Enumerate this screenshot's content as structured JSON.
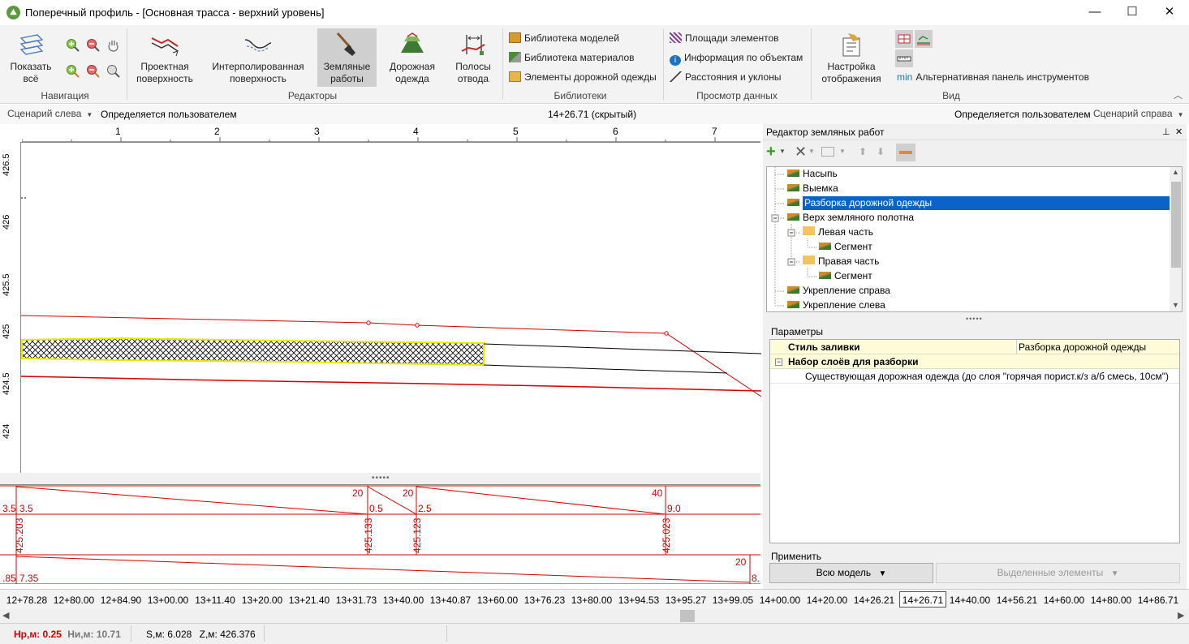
{
  "window": {
    "title": "Поперечный профиль - [Основная трасса - верхний уровень]",
    "controls": {
      "minimize": "—",
      "maximize": "☐",
      "close": "✕"
    }
  },
  "ribbon": {
    "navigation": {
      "show_all": "Показать всё",
      "group": "Навигация"
    },
    "editors": {
      "design_surface": "Проектная поверхность",
      "interpolated_surface": "Интерполированная поверхность",
      "earthworks": "Земляные работы",
      "pavement": "Дорожная одежда",
      "right_of_way": "Полосы отвода",
      "group": "Редакторы"
    },
    "libraries": {
      "models": "Библиотека моделей",
      "materials": "Библиотека материалов",
      "pavement_elements": "Элементы дорожной одежды",
      "group": "Библиотеки"
    },
    "data_view": {
      "element_areas": "Площади элементов",
      "object_info": "Информация по объектам",
      "distances": "Расстояния и уклоны",
      "group": "Просмотр данных"
    },
    "view": {
      "display_settings": "Настройка отображения",
      "alt_toolbar_prefix": "min",
      "alt_toolbar": "Альтернативная панель инструментов",
      "group": "Вид"
    }
  },
  "scenario_bar": {
    "left_scenario": "Сценарий слева",
    "left_value": "Определяется пользователем",
    "station": "14+26.71 (скрытый)",
    "right_value": "Определяется пользователем",
    "right_scenario": "Сценарий справа"
  },
  "ruler_top": [
    "1",
    "2",
    "3",
    "4",
    "5",
    "6",
    "7"
  ],
  "ruler_left": [
    "426.5",
    "426",
    "425.5",
    "425",
    "424.5",
    "424"
  ],
  "profile_grid": {
    "row1": [
      "20",
      "20",
      "40"
    ],
    "row2": [
      "3.5",
      "3.5",
      "0.5",
      "2.5",
      "9.0"
    ],
    "row3": [
      "425.203",
      "425.133",
      "425.123",
      "425.023"
    ],
    "row4": [
      "20",
      ".85",
      "7.35",
      "8."
    ]
  },
  "stations": [
    "12+78.28",
    "12+80.00",
    "12+84.90",
    "13+00.00",
    "13+11.40",
    "13+20.00",
    "13+21.40",
    "13+31.73",
    "13+40.00",
    "13+40.87",
    "13+60.00",
    "13+76.23",
    "13+80.00",
    "13+94.53",
    "13+95.27",
    "13+99.05",
    "14+00.00",
    "14+20.00",
    "14+26.21",
    "14+26.71",
    "14+40.00",
    "14+56.21",
    "14+60.00",
    "14+80.00",
    "14+86.71"
  ],
  "selected_station": "14+26.71",
  "statusbar": {
    "hr_label": "Нр,м:",
    "hr_value": "0.25",
    "hi_label": "Ни,м:",
    "hi_value": "10.71",
    "s_label": "S,м:",
    "s_value": "6.028",
    "z_label": "Z,м:",
    "z_value": "426.376"
  },
  "earthworks_editor": {
    "title": "Редактор земляных работ",
    "tree": [
      {
        "label": "Насыпь"
      },
      {
        "label": "Выемка"
      },
      {
        "label": "Разборка дорожной одежды"
      },
      {
        "label": "Верх земляного полотна"
      },
      {
        "label": "Левая часть"
      },
      {
        "label": "Сегмент"
      },
      {
        "label": "Правая часть"
      },
      {
        "label": "Сегмент"
      },
      {
        "label": "Укрепление справа"
      },
      {
        "label": "Укрепление слева"
      }
    ],
    "params_title": "Параметры",
    "params": {
      "fill_style_label": "Стиль заливки",
      "fill_style_value": "Разборка дорожной одежды",
      "layer_set_label": "Набор слоёв для разборки",
      "layer_item": "Существующая дорожная одежда (до слоя \"горячая порист.к/з а/б смесь, 10см\")"
    },
    "apply_title": "Применить",
    "apply_all": "Всю модель",
    "apply_selected": "Выделенные элементы"
  },
  "colors": {
    "accent_red": "#d40000",
    "selection_blue": "#0a64c8",
    "hatch_yellow": "#ffff00"
  }
}
